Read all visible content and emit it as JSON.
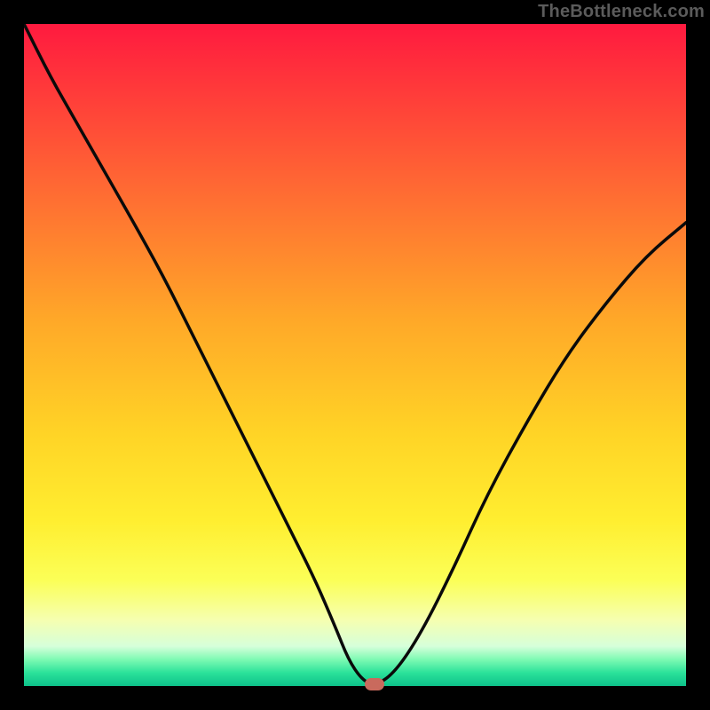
{
  "watermark": "TheBottleneck.com",
  "colors": {
    "frame": "#000000",
    "curve": "#101010",
    "marker": "#c96a5d",
    "gradient_top": "#ff1a3f",
    "gradient_bottom": "#0dc18a"
  },
  "chart_data": {
    "type": "line",
    "title": "",
    "xlabel": "",
    "ylabel": "",
    "xlim": [
      0,
      100
    ],
    "ylim": [
      0,
      100
    ],
    "series": [
      {
        "name": "bottleneck-curve-left",
        "x": [
          0,
          4,
          8,
          12,
          16,
          21,
          26,
          31,
          36,
          40,
          44,
          47,
          49,
          51,
          53
        ],
        "values": [
          100,
          92,
          85,
          78,
          71,
          62,
          52,
          42,
          32,
          24,
          16,
          9,
          4,
          1,
          0
        ]
      },
      {
        "name": "bottleneck-curve-right",
        "x": [
          53,
          56,
          60,
          65,
          70,
          76,
          82,
          88,
          94,
          100
        ],
        "values": [
          0,
          2,
          8,
          18,
          29,
          40,
          50,
          58,
          65,
          70
        ]
      }
    ],
    "annotations": [
      {
        "name": "optimal-marker",
        "x": 53,
        "y": 0
      }
    ],
    "grid": false,
    "legend": false
  }
}
